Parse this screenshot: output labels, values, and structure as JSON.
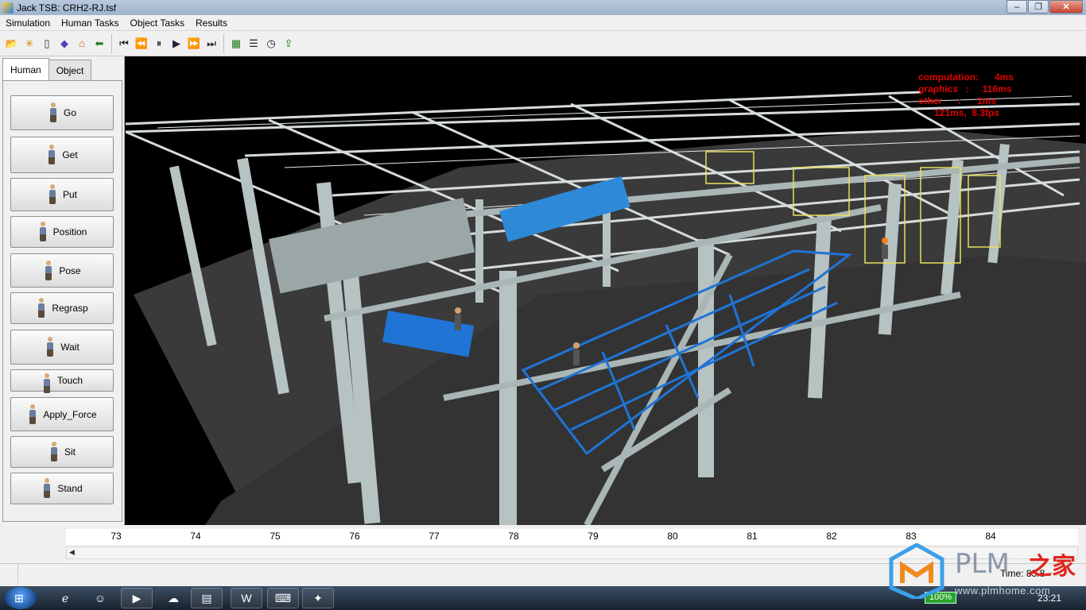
{
  "window": {
    "title": "Jack TSB:  CRH2-RJ.tsf",
    "buttons": {
      "minimize": "–",
      "maximize": "❐",
      "close": "✕"
    }
  },
  "menu": [
    "Simulation",
    "Human Tasks",
    "Object Tasks",
    "Results"
  ],
  "toolbar": {
    "file_icons": [
      "open-folder-icon",
      "new-icon",
      "blank-page-icon",
      "cube-icon",
      "house-icon",
      "back-arrow-icon"
    ],
    "playback_icons": [
      "skip-to-start-icon",
      "rewind-icon",
      "pause-icon",
      "play-icon",
      "fast-forward-icon",
      "skip-to-end-icon"
    ],
    "result_icons": [
      "chart-icon",
      "report-icon",
      "clock-icon",
      "export-icon"
    ]
  },
  "tabs": [
    "Human",
    "Object"
  ],
  "human_tasks": [
    "Go",
    "Get",
    "Put",
    "Position",
    "Pose",
    "Regrasp",
    "Wait",
    "Touch",
    "Apply_Force",
    "Sit",
    "Stand"
  ],
  "stats": {
    "computation": "computation:      4ms",
    "graphics": "graphics   :     116ms",
    "other": "other      :      1ms",
    "total": "121ms,  8.3fps"
  },
  "timeline": {
    "ticks": [
      "73",
      "74",
      "75",
      "76",
      "77",
      "78",
      "79",
      "80",
      "81",
      "82",
      "83",
      "84"
    ],
    "status_time": "Time: 83.8"
  },
  "taskbar": {
    "battery": "100%",
    "clock": "23:21",
    "apps": [
      "ie-icon",
      "finder-icon",
      "media-icon",
      "network-icon",
      "explorer-icon",
      "word-icon",
      "cmd-icon",
      "jack-icon"
    ]
  },
  "watermark": {
    "brand": "PLM",
    "suffix": "之家",
    "url": "www.plmhome.com"
  },
  "colors": {
    "viewport_bg": "#000000",
    "stats_text": "#e00000",
    "steel": "#c9d2d2",
    "racks": "#1f74d6"
  }
}
